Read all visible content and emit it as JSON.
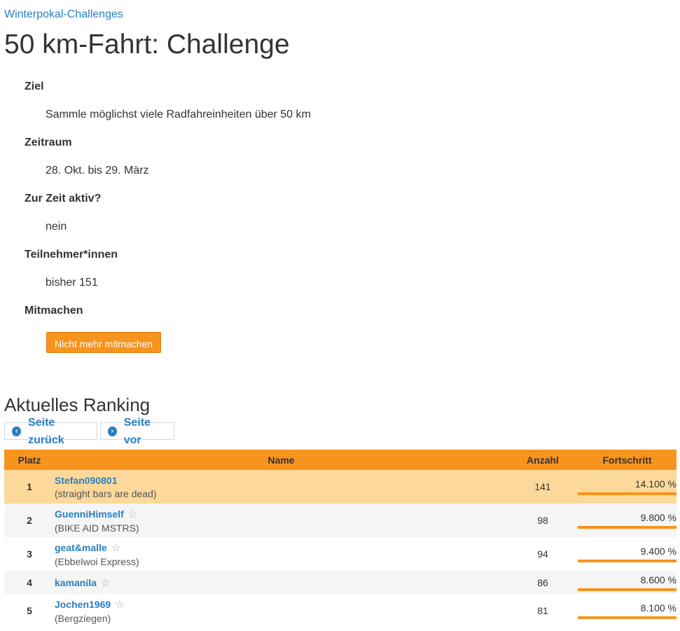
{
  "breadcrumb": "Winterpokal-Challenges",
  "title": "50 km-Fahrt: Challenge",
  "details": [
    {
      "label": "Ziel",
      "value": "Sammle möglichst viele Radfahreinheiten über 50 km"
    },
    {
      "label": "Zeitraum",
      "value": "28. Okt. bis 29. März"
    },
    {
      "label": "Zur Zeit aktiv?",
      "value": "nein"
    },
    {
      "label": "Teilnehmer*innen",
      "value": "bisher 151"
    },
    {
      "label": "Mitmachen",
      "value": ""
    }
  ],
  "join_button": "Nicht mehr mitmachen",
  "ranking": {
    "heading": "Aktuelles Ranking",
    "prev_label": "Seite zurück",
    "next_label": "Seite vor",
    "columns": [
      "Platz",
      "Name",
      "Anzahl",
      "Fortschritt"
    ],
    "rows": [
      {
        "platz": "1",
        "name": "Stefan090801",
        "team": "(straight bars are dead)",
        "anzahl": "141",
        "progress": "14.100 %",
        "starred": false
      },
      {
        "platz": "2",
        "name": "GuenniHimself",
        "team": "(BIKE AID MSTRS)",
        "anzahl": "98",
        "progress": "9.800 %",
        "starred": true
      },
      {
        "platz": "3",
        "name": "geat&malle",
        "team": "(Ebbelwoi Express)",
        "anzahl": "94",
        "progress": "9.400 %",
        "starred": true
      },
      {
        "platz": "4",
        "name": "kamanila",
        "team": "",
        "anzahl": "86",
        "progress": "8.600 %",
        "starred": true
      },
      {
        "platz": "5",
        "name": "Jochen1969",
        "team": "(Bergziegen)",
        "anzahl": "81",
        "progress": "8.100 %",
        "starred": true
      }
    ]
  },
  "colors": {
    "accent": "#f7941d",
    "link": "#2a7fc1",
    "highlight_row": "#fcd99a"
  }
}
